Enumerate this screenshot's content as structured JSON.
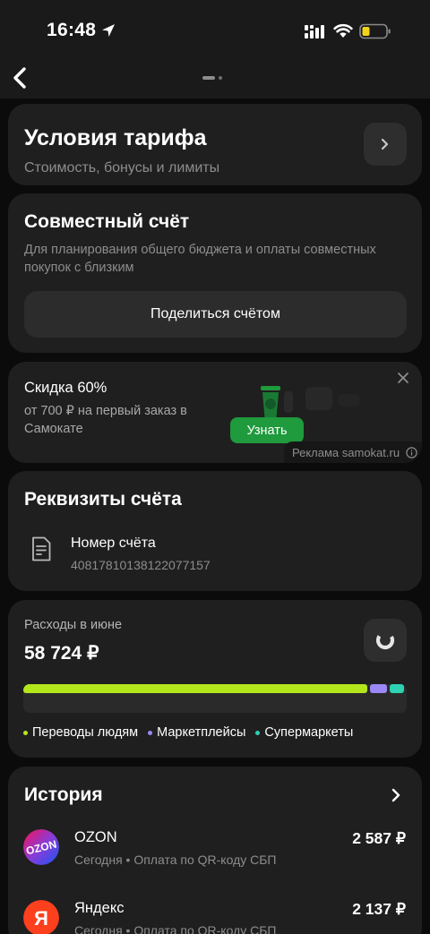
{
  "status_bar": {
    "time": "16:48"
  },
  "tariff": {
    "title": "Условия тарифа",
    "subtitle": "Стоимость, бонусы и лимиты"
  },
  "joint": {
    "title": "Совместный счёт",
    "description": "Для планирования общего бюджета и оплаты совместных покупок с близким",
    "button": "Поделиться счётом"
  },
  "ad": {
    "title": "Скидка 60%",
    "description": "от 700 ₽ на первый заказ в Самокате",
    "button": "Узнать",
    "label": "Реклама samokat.ru",
    "colors": {
      "button": "#1f9a3d",
      "cup": "#1f9a3d"
    }
  },
  "requisites": {
    "title": "Реквизиты счёта",
    "account_label": "Номер счёта",
    "account_number": "40817810138122077157"
  },
  "expenses": {
    "label": "Расходы в июне",
    "amount": "58 724 ₽",
    "segments": [
      {
        "name": "Переводы людям",
        "share": 0.9,
        "color": "#b4e61c"
      },
      {
        "name": "Маркетплейсы",
        "share": 0.045,
        "color": "#9b87f5"
      },
      {
        "name": "Супермаркеты",
        "share": 0.038,
        "color": "#2ed1b2"
      }
    ]
  },
  "history": {
    "title": "История",
    "items": [
      {
        "logo": "ozon-logo",
        "logo_text": "OZON",
        "name": "OZON",
        "subtitle": "Сегодня • Оплата по QR-коду СБП",
        "amount": "2 587 ₽"
      },
      {
        "logo": "yandex-logo",
        "logo_text": "Я",
        "name": "Яндекс",
        "subtitle": "Сегодня • Оплата по QR-коду СБП",
        "amount": "2 137 ₽"
      }
    ]
  }
}
